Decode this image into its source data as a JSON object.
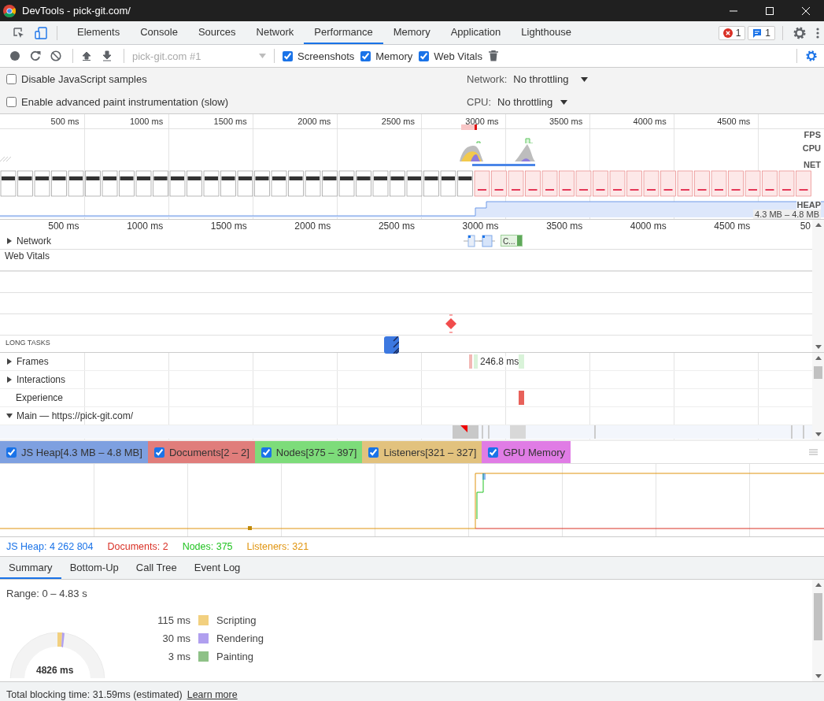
{
  "window": {
    "title": "DevTools - pick-git.com/"
  },
  "tabs": [
    {
      "label": "Elements",
      "selected": false
    },
    {
      "label": "Console",
      "selected": false
    },
    {
      "label": "Sources",
      "selected": false
    },
    {
      "label": "Network",
      "selected": false
    },
    {
      "label": "Performance",
      "selected": true
    },
    {
      "label": "Memory",
      "selected": false
    },
    {
      "label": "Application",
      "selected": false
    },
    {
      "label": "Lighthouse",
      "selected": false
    }
  ],
  "badges": {
    "errors": "1",
    "messages": "1"
  },
  "toolbar": {
    "target": "pick-git.com #1",
    "checkboxes": [
      {
        "label": "Screenshots",
        "checked": true
      },
      {
        "label": "Memory",
        "checked": true
      },
      {
        "label": "Web Vitals",
        "checked": true
      }
    ]
  },
  "settings": {
    "options": [
      {
        "label": "Disable JavaScript samples",
        "checked": false
      },
      {
        "label": "Enable advanced paint instrumentation (slow)",
        "checked": false
      }
    ],
    "throttling": [
      {
        "label": "Network:",
        "value": "No throttling"
      },
      {
        "label": "CPU:",
        "value": "No throttling"
      }
    ]
  },
  "overview": {
    "ticks": [
      "500 ms",
      "1000 ms",
      "1500 ms",
      "2000 ms",
      "2500 ms",
      "3000 ms",
      "3500 ms",
      "4000 ms",
      "4500 ms"
    ],
    "tracks": [
      "FPS",
      "CPU",
      "NET",
      "HEAP"
    ],
    "heap_range": "4.3 MB – 4.8 MB"
  },
  "timeline": {
    "ticks": [
      "500 ms",
      "1000 ms",
      "1500 ms",
      "2000 ms",
      "2500 ms",
      "3000 ms",
      "3500 ms",
      "4000 ms",
      "4500 ms",
      "50"
    ],
    "network": {
      "label": "Network",
      "expanded": false,
      "request": "C..."
    },
    "web_vitals": "Web Vitals",
    "long_tasks": "LONG TASKS",
    "tracks": [
      {
        "label": "Frames",
        "kind": "expandable",
        "expanded": false
      },
      {
        "label": "Interactions",
        "kind": "expandable",
        "expanded": false
      },
      {
        "label": "Experience",
        "kind": "plain"
      },
      {
        "label": "Main — https://pick-git.com/",
        "kind": "expandable",
        "expanded": true
      }
    ],
    "frame_duration": "246.8 ms"
  },
  "counters": [
    {
      "label": "JS Heap[4.3 MB – 4.8 MB]",
      "checked": true,
      "color": "#7ea0e0"
    },
    {
      "label": "Documents[2 – 2]",
      "checked": true,
      "color": "#e07d7b"
    },
    {
      "label": "Nodes[375 – 397]",
      "checked": true,
      "color": "#7ddc7a"
    },
    {
      "label": "Listeners[321 – 327]",
      "checked": true,
      "color": "#e2c27e"
    },
    {
      "label": "GPU Memory",
      "checked": true,
      "color": "#e07ce5"
    }
  ],
  "counter_values": [
    {
      "text": "JS Heap: 4 262 804",
      "color": "#1a73e8"
    },
    {
      "text": "Documents: 2",
      "color": "#d93025"
    },
    {
      "text": "Nodes: 375",
      "color": "#22c322"
    },
    {
      "text": "Listeners: 321",
      "color": "#e0940e"
    }
  ],
  "bottom_tabs": [
    {
      "label": "Summary",
      "selected": true
    },
    {
      "label": "Bottom-Up",
      "selected": false
    },
    {
      "label": "Call Tree",
      "selected": false
    },
    {
      "label": "Event Log",
      "selected": false
    }
  ],
  "summary": {
    "range": "Range: 0 – 4.83 s",
    "total": "4826 ms",
    "legend": [
      {
        "value": "115 ms",
        "label": "Scripting",
        "color": "#f2d07f"
      },
      {
        "value": "30 ms",
        "label": "Rendering",
        "color": "#b09fef"
      },
      {
        "value": "3 ms",
        "label": "Painting",
        "color": "#8ec187"
      }
    ]
  },
  "status_bar": {
    "text": "Total blocking time: 31.59ms (estimated)",
    "link": "Learn more"
  }
}
